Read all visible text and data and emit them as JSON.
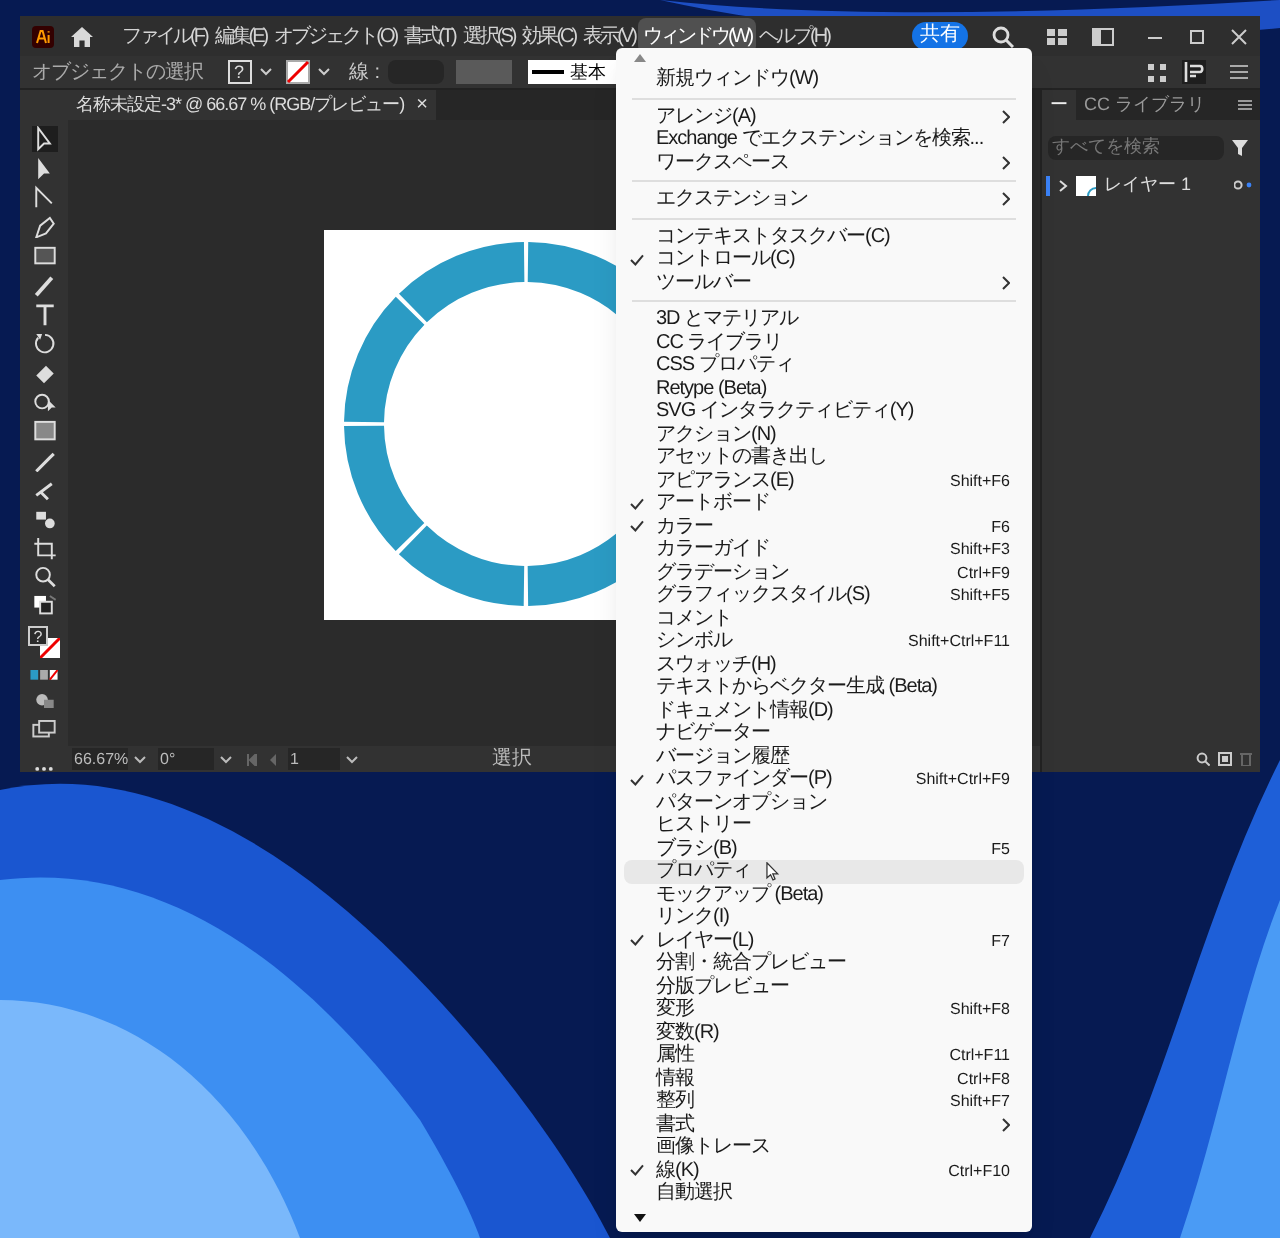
{
  "title_bar": {
    "menu_bar": [
      {
        "label": "ファイル(F)",
        "selected": false
      },
      {
        "label": "編集(E)",
        "selected": false
      },
      {
        "label": "オブジェクト(O)",
        "selected": false
      },
      {
        "label": "書式(T)",
        "selected": false
      },
      {
        "label": "選択(S)",
        "selected": false
      },
      {
        "label": "効果(C)",
        "selected": false
      },
      {
        "label": "表示(V)",
        "selected": false
      },
      {
        "label": "ウィンドウ(W)",
        "selected": true
      },
      {
        "label": "ヘルプ(H)",
        "selected": false
      }
    ],
    "share_button": "共有"
  },
  "control_bar": {
    "label": "オブジェクトの選択",
    "fill_box": "?",
    "stroke_label": "線 :",
    "stroke_style": "基本"
  },
  "document_tab": {
    "title": "名称未設定-3* @ 66.67 % (RGB/プレビュー)",
    "close": "×"
  },
  "toolbar": {
    "fill_box": "?"
  },
  "panel": {
    "tabs": [
      {
        "label": "ー",
        "selected": true
      },
      {
        "label": "CC ライブラリ",
        "selected": false
      }
    ],
    "search": {
      "placeholder": "すべてを検索"
    },
    "layers": [
      {
        "name": "レイヤー 1",
        "expanded": false
      }
    ]
  },
  "status_bar": {
    "zoom": "66.67%",
    "rotation": "0°",
    "artboard": "1",
    "tool": "選択"
  },
  "window_menu": {
    "items": [
      {
        "kind": "item",
        "label": "新規ウィンドウ(W)",
        "checked": false,
        "submenu": false,
        "selected": false
      },
      {
        "kind": "separator"
      },
      {
        "kind": "item",
        "label": "アレンジ(A)",
        "checked": false,
        "submenu": true,
        "selected": false
      },
      {
        "kind": "item",
        "label": "Exchange でエクステンションを検索...",
        "checked": false,
        "submenu": false,
        "selected": false
      },
      {
        "kind": "item",
        "label": "ワークスペース",
        "checked": false,
        "submenu": true,
        "selected": false
      },
      {
        "kind": "separator"
      },
      {
        "kind": "item",
        "label": "エクステンション",
        "checked": false,
        "submenu": true,
        "selected": false
      },
      {
        "kind": "separator"
      },
      {
        "kind": "item",
        "label": "コンテキストタスクバー(C)",
        "checked": false,
        "submenu": false,
        "selected": false
      },
      {
        "kind": "item",
        "label": "コントロール(C)",
        "checked": true,
        "submenu": false,
        "selected": false
      },
      {
        "kind": "item",
        "label": "ツールバー",
        "checked": false,
        "submenu": true,
        "selected": false
      },
      {
        "kind": "separator"
      },
      {
        "kind": "item",
        "label": "3D とマテリアル",
        "checked": false,
        "submenu": false,
        "selected": false
      },
      {
        "kind": "item",
        "label": "CC ライブラリ",
        "checked": false,
        "submenu": false,
        "selected": false
      },
      {
        "kind": "item",
        "label": "CSS プロパティ",
        "checked": false,
        "submenu": false,
        "selected": false
      },
      {
        "kind": "item",
        "label": "Retype (Beta)",
        "checked": false,
        "submenu": false,
        "selected": false
      },
      {
        "kind": "item",
        "label": "SVG インタラクティビティ(Y)",
        "checked": false,
        "submenu": false,
        "selected": false
      },
      {
        "kind": "item",
        "label": "アクション(N)",
        "checked": false,
        "submenu": false,
        "selected": false
      },
      {
        "kind": "item",
        "label": "アセットの書き出し",
        "checked": false,
        "submenu": false,
        "selected": false
      },
      {
        "kind": "item",
        "label": "アピアランス(E)",
        "shortcut": "Shift+F6",
        "checked": false,
        "submenu": false,
        "selected": false
      },
      {
        "kind": "item",
        "label": "アートボード",
        "checked": true,
        "submenu": false,
        "selected": false
      },
      {
        "kind": "item",
        "label": "カラー",
        "shortcut": "F6",
        "checked": true,
        "submenu": false,
        "selected": false
      },
      {
        "kind": "item",
        "label": "カラーガイド",
        "shortcut": "Shift+F3",
        "checked": false,
        "submenu": false,
        "selected": false
      },
      {
        "kind": "item",
        "label": "グラデーション",
        "shortcut": "Ctrl+F9",
        "checked": false,
        "submenu": false,
        "selected": false
      },
      {
        "kind": "item",
        "label": "グラフィックスタイル(S)",
        "shortcut": "Shift+F5",
        "checked": false,
        "submenu": false,
        "selected": false
      },
      {
        "kind": "item",
        "label": "コメント",
        "checked": false,
        "submenu": false,
        "selected": false
      },
      {
        "kind": "item",
        "label": "シンボル",
        "shortcut": "Shift+Ctrl+F11",
        "checked": false,
        "submenu": false,
        "selected": false
      },
      {
        "kind": "item",
        "label": "スウォッチ(H)",
        "checked": false,
        "submenu": false,
        "selected": false
      },
      {
        "kind": "item",
        "label": "テキストからベクター生成 (Beta)",
        "checked": false,
        "submenu": false,
        "selected": false
      },
      {
        "kind": "item",
        "label": "ドキュメント情報(D)",
        "checked": false,
        "submenu": false,
        "selected": false
      },
      {
        "kind": "item",
        "label": "ナビゲーター",
        "checked": false,
        "submenu": false,
        "selected": false
      },
      {
        "kind": "item",
        "label": "バージョン履歴",
        "checked": false,
        "submenu": false,
        "selected": false
      },
      {
        "kind": "item",
        "label": "パスファインダー(P)",
        "shortcut": "Shift+Ctrl+F9",
        "checked": true,
        "submenu": false,
        "selected": false
      },
      {
        "kind": "item",
        "label": "パターンオプション",
        "checked": false,
        "submenu": false,
        "selected": false
      },
      {
        "kind": "item",
        "label": "ヒストリー",
        "checked": false,
        "submenu": false,
        "selected": false
      },
      {
        "kind": "item",
        "label": "ブラシ(B)",
        "shortcut": "F5",
        "checked": false,
        "submenu": false,
        "selected": false
      },
      {
        "kind": "item",
        "label": "プロパティ",
        "checked": false,
        "submenu": false,
        "selected": true
      },
      {
        "kind": "item",
        "label": "モックアップ (Beta)",
        "checked": false,
        "submenu": false,
        "selected": false
      },
      {
        "kind": "item",
        "label": "リンク(I)",
        "checked": false,
        "submenu": false,
        "selected": false
      },
      {
        "kind": "item",
        "label": "レイヤー(L)",
        "shortcut": "F7",
        "checked": true,
        "submenu": false,
        "selected": false
      },
      {
        "kind": "item",
        "label": "分割・統合プレビュー",
        "checked": false,
        "submenu": false,
        "selected": false
      },
      {
        "kind": "item",
        "label": "分版プレビュー",
        "checked": false,
        "submenu": false,
        "selected": false
      },
      {
        "kind": "item",
        "label": "変形",
        "shortcut": "Shift+F8",
        "checked": false,
        "submenu": false,
        "selected": false
      },
      {
        "kind": "item",
        "label": "変数(R)",
        "checked": false,
        "submenu": false,
        "selected": false
      },
      {
        "kind": "item",
        "label": "属性",
        "shortcut": "Ctrl+F11",
        "checked": false,
        "submenu": false,
        "selected": false
      },
      {
        "kind": "item",
        "label": "情報",
        "shortcut": "Ctrl+F8",
        "checked": false,
        "submenu": false,
        "selected": false
      },
      {
        "kind": "item",
        "label": "整列",
        "shortcut": "Shift+F7",
        "checked": false,
        "submenu": false,
        "selected": false
      },
      {
        "kind": "item",
        "label": "書式",
        "checked": false,
        "submenu": true,
        "selected": false
      },
      {
        "kind": "item",
        "label": "画像トレース",
        "checked": false,
        "submenu": false,
        "selected": false
      },
      {
        "kind": "item",
        "label": "線(K)",
        "shortcut": "Ctrl+F10",
        "checked": true,
        "submenu": false,
        "selected": false
      },
      {
        "kind": "item",
        "label": "自動選択",
        "checked": false,
        "submenu": false,
        "selected": false
      }
    ]
  }
}
